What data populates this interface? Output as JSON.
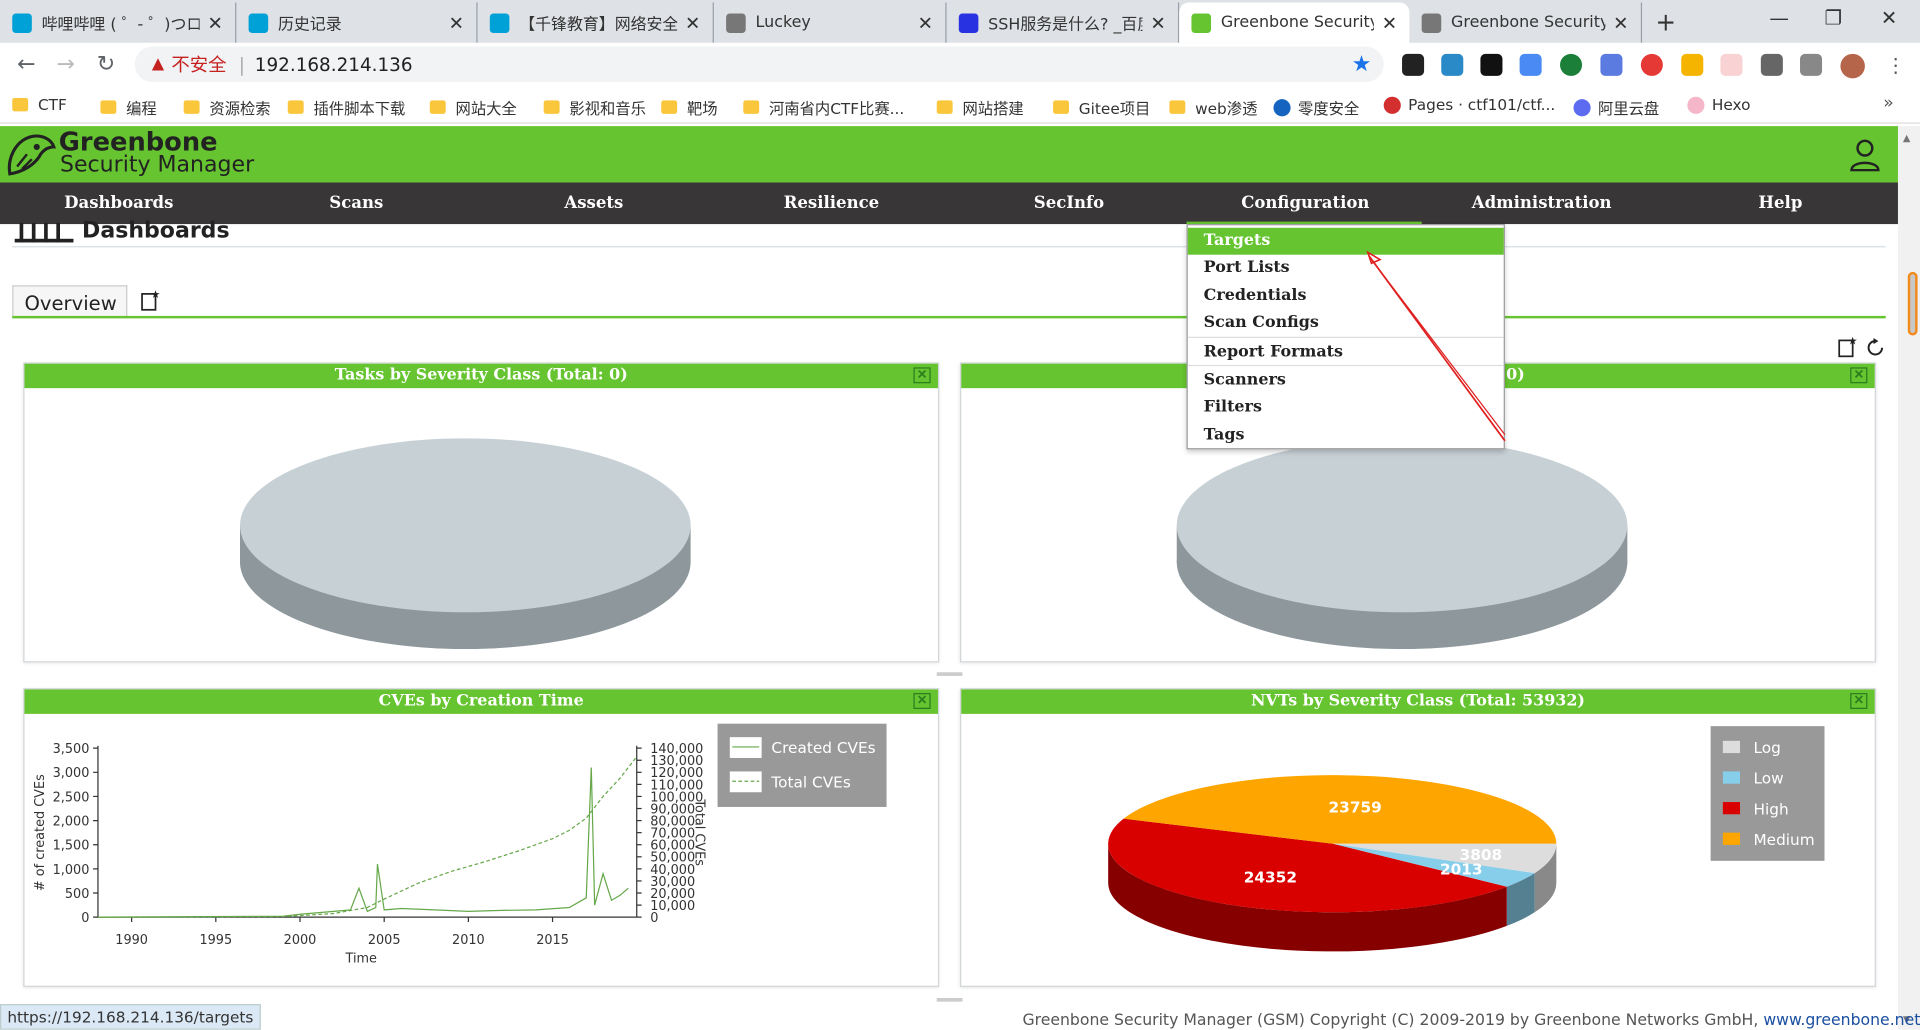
{
  "browser": {
    "tabs": [
      {
        "title": "哔哩哔哩 ( ゜- ゜)つロ 干",
        "favicon": "bilibili-icon",
        "color": "#00a1d6"
      },
      {
        "title": "历史记录",
        "favicon": "bilibili-icon",
        "color": "#00a1d6"
      },
      {
        "title": "【千锋教育】网络安全",
        "favicon": "bilibili-icon",
        "color": "#00a1d6"
      },
      {
        "title": "Luckey",
        "favicon": "globe-icon",
        "color": "#777777"
      },
      {
        "title": "SSH服务是什么? _百度",
        "favicon": "baidu-icon",
        "color": "#2932e1"
      },
      {
        "title": "Greenbone Security A",
        "favicon": "greenbone-icon",
        "color": "#66c430"
      },
      {
        "title": "Greenbone Security M",
        "favicon": "globe-icon",
        "color": "#777777"
      }
    ],
    "active_tab": 5,
    "address": {
      "warning": "不安全",
      "url": "192.168.214.136"
    },
    "bookmarks": [
      "CTF",
      "编程",
      "资源检索",
      "插件脚本下载",
      "网站大全",
      "影视和音乐",
      "靶场",
      "河南省内CTF比赛...",
      "网站搭建",
      "Gitee项目",
      "web渗透",
      "零度安全",
      "Pages · ctf101/ctf...",
      "阿里云盘",
      "Hexo"
    ],
    "status_url": "https://192.168.214.136/targets"
  },
  "app": {
    "logo_line1": "Greenbone",
    "logo_line2": "Security Manager",
    "menu": [
      "Dashboards",
      "Scans",
      "Assets",
      "Resilience",
      "SecInfo",
      "Configuration",
      "Administration",
      "Help"
    ],
    "page_title": "Dashboards",
    "dashboard_tab": "Overview",
    "config_menu": [
      "Targets",
      "Port Lists",
      "Credentials",
      "Scan Configs",
      "Report Formats",
      "Scanners",
      "Filters",
      "Tags"
    ],
    "config_selected": "Targets",
    "footer_text": "Greenbone Security Manager (GSM) Copyright (C) 2009-2019 by Greenbone Networks GmbH,",
    "footer_link": "www.greenbone.net"
  },
  "panels": {
    "tasks_title": "Tasks by Severity Class (Total: 0)",
    "second_title_visible": "0)",
    "cves_title": "CVEs by Creation Time",
    "nvts_title": "NVTs by Severity Class (Total: 53932)"
  },
  "chart_data": [
    {
      "type": "line",
      "title": "CVEs by Creation Time",
      "xlabel": "Time",
      "ylabel": "# of created CVEs",
      "y2label": "Total CVEs",
      "x_ticks": [
        "1990",
        "1995",
        "2000",
        "2005",
        "2010",
        "2015"
      ],
      "y_ticks": [
        "0",
        "500",
        "1,000",
        "1,500",
        "2,000",
        "2,500",
        "3,000",
        "3,500"
      ],
      "y2_ticks": [
        "0",
        "10,000",
        "20,000",
        "30,000",
        "40,000",
        "50,000",
        "60,000",
        "70,000",
        "80,000",
        "90,000",
        "100,000",
        "110,000",
        "120,000",
        "130,000",
        "140,000"
      ],
      "ylim": [
        0,
        3500
      ],
      "y2lim": [
        0,
        140000
      ],
      "xlim": [
        1988,
        2020
      ],
      "series": [
        {
          "name": "Created CVEs",
          "style": "solid",
          "color": "#66a84a",
          "x": [
            1988,
            1999,
            2000,
            2002,
            2003,
            2003.5,
            2004,
            2004.5,
            2004.6,
            2005,
            2006,
            2008,
            2010,
            2012,
            2014,
            2016,
            2017,
            2017.3,
            2017.5,
            2018,
            2018.5,
            2019,
            2019.5
          ],
          "y": [
            0,
            20,
            60,
            120,
            150,
            600,
            120,
            200,
            1100,
            150,
            180,
            150,
            120,
            140,
            150,
            200,
            400,
            3100,
            250,
            900,
            350,
            450,
            600
          ]
        },
        {
          "name": "Total CVEs",
          "style": "dashed",
          "color": "#66a84a",
          "x": [
            1988,
            1999,
            2002,
            2004,
            2005,
            2007,
            2009,
            2011,
            2013,
            2015,
            2016,
            2017,
            2018,
            2019,
            2020
          ],
          "y": [
            0,
            500,
            3000,
            8000,
            15000,
            28000,
            38000,
            46000,
            55000,
            65000,
            72000,
            82000,
            100000,
            115000,
            133000
          ]
        }
      ],
      "legend": "top-right"
    },
    {
      "type": "pie",
      "title": "NVTs by Severity Class (Total: 53932)",
      "labels": [
        "Log",
        "Low",
        "High",
        "Medium"
      ],
      "values": [
        3808,
        2013,
        24352,
        23759
      ],
      "colors": {
        "Log": "#dddddd",
        "Low": "#87ceeb",
        "High": "#d90000",
        "Medium": "#ffa500"
      },
      "legend": "top-right"
    }
  ]
}
